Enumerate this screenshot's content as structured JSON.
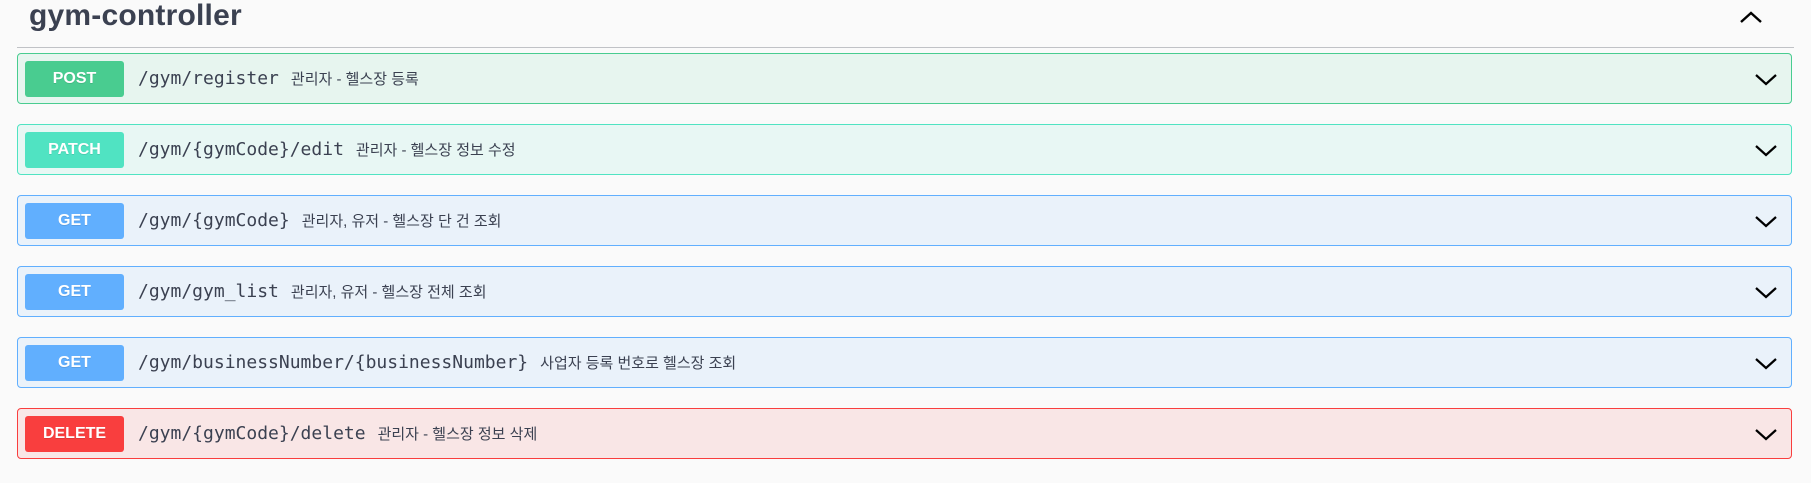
{
  "section": {
    "title": "gym-controller"
  },
  "operations": [
    {
      "method": "POST",
      "path": "/gym/register",
      "summary": "관리자 - 헬스장 등록"
    },
    {
      "method": "PATCH",
      "path": "/gym/{gymCode}/edit",
      "summary": "관리자 - 헬스장 정보 수정"
    },
    {
      "method": "GET",
      "path": "/gym/{gymCode}",
      "summary": "관리자, 유저 - 헬스장 단 건 조회"
    },
    {
      "method": "GET",
      "path": "/gym/gym_list",
      "summary": "관리자, 유저 - 헬스장 전체 조회"
    },
    {
      "method": "GET",
      "path": "/gym/businessNumber/{businessNumber}",
      "summary": "사업자 등록 번호로 헬스장 조회"
    },
    {
      "method": "DELETE",
      "path": "/gym/{gymCode}/delete",
      "summary": "관리자 - 헬스장 정보 삭제"
    }
  ],
  "icons": {
    "collapse": "chevron-up-icon",
    "expand": "chevron-down-icon"
  },
  "colors": {
    "post": "#49cc90",
    "patch": "#50e3c2",
    "get": "#61affe",
    "delete": "#f93e3e",
    "text": "#3b4151"
  }
}
